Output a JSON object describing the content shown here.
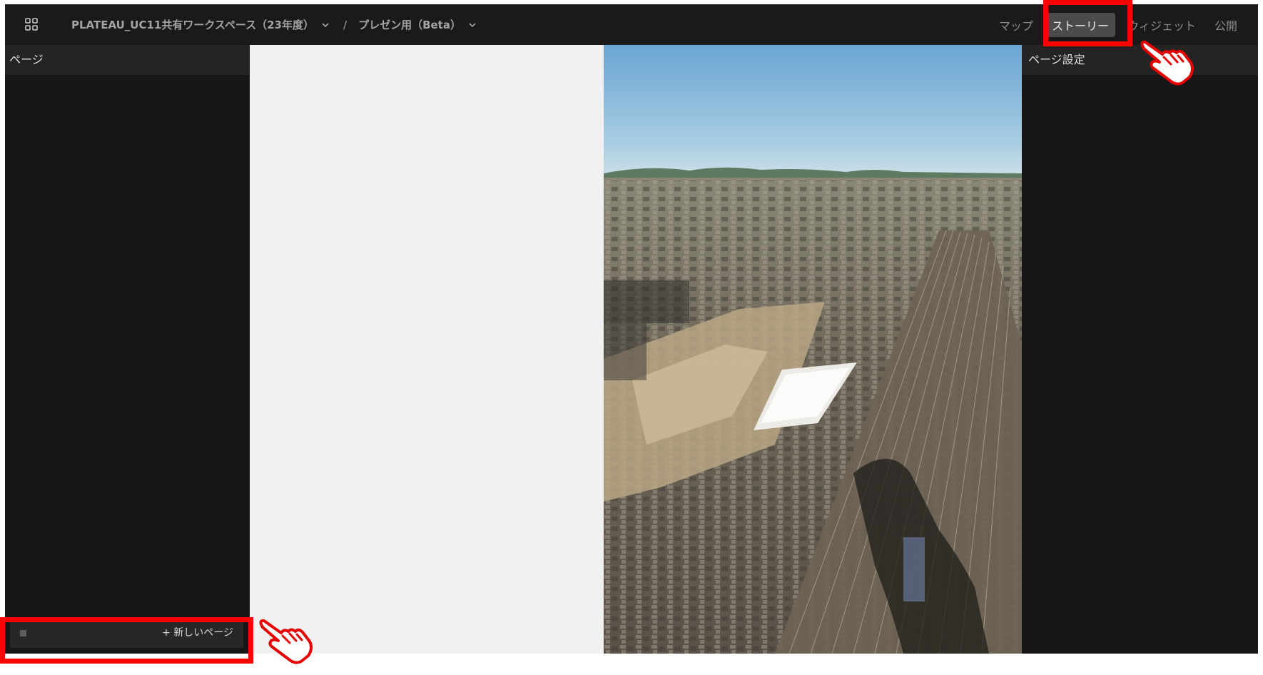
{
  "header": {
    "apps_icon": "grid-icon",
    "workspace": "PLATEAU_UC11共有ワークスペース（23年度）",
    "separator": "/",
    "project": "プレゼン用（Beta）",
    "tabs": [
      {
        "label": "マップ",
        "active": false
      },
      {
        "label": "ストーリー",
        "active": true
      },
      {
        "label": "ウィジェット",
        "active": false
      },
      {
        "label": "公開",
        "active": false
      }
    ]
  },
  "left_panel": {
    "title": "ページ",
    "new_page_label": "+ 新しいページ"
  },
  "right_panel": {
    "title": "ページ設定"
  },
  "colors": {
    "background": "#161616",
    "header": "#1a1a1a",
    "panel_header": "#242424",
    "active_tab": "#4b4b4b",
    "canvas": "#f1f1f1",
    "highlight": "#ff0000"
  }
}
